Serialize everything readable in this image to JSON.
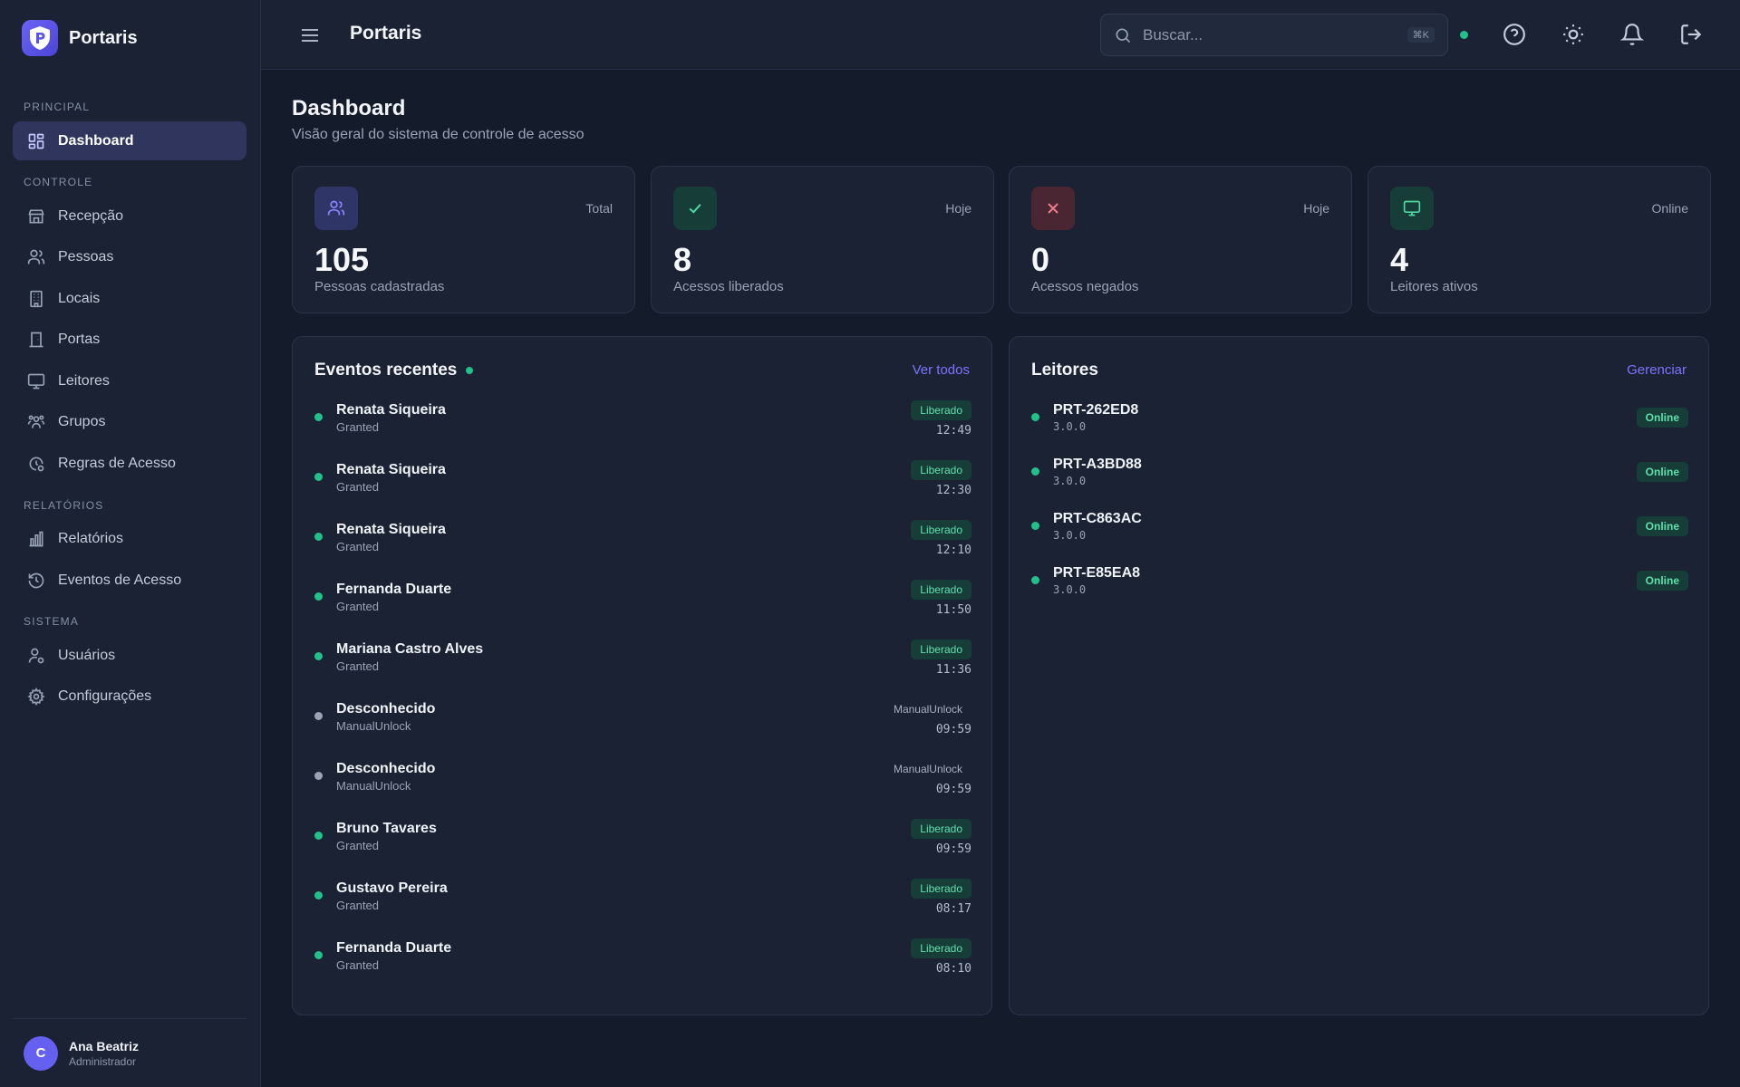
{
  "app": {
    "name": "Portaris"
  },
  "topbar": {
    "title": "Portaris",
    "search_placeholder": "Buscar...",
    "search_shortcut": "⌘K"
  },
  "sidebar": {
    "sections": [
      {
        "label": "PRINCIPAL",
        "items": [
          {
            "label": "Dashboard",
            "icon": "dashboard-icon",
            "active": true
          }
        ]
      },
      {
        "label": "CONTROLE",
        "items": [
          {
            "label": "Recepção",
            "icon": "store-icon"
          },
          {
            "label": "Pessoas",
            "icon": "users-icon"
          },
          {
            "label": "Locais",
            "icon": "building-icon"
          },
          {
            "label": "Portas",
            "icon": "door-icon"
          },
          {
            "label": "Leitores",
            "icon": "monitor-icon"
          },
          {
            "label": "Grupos",
            "icon": "group-icon"
          },
          {
            "label": "Regras de Acesso",
            "icon": "clock-rule-icon"
          }
        ]
      },
      {
        "label": "RELATÓRIOS",
        "items": [
          {
            "label": "Relatórios",
            "icon": "bar-chart-icon"
          },
          {
            "label": "Eventos de Acesso",
            "icon": "history-icon"
          }
        ]
      },
      {
        "label": "SISTEMA",
        "items": [
          {
            "label": "Usuários",
            "icon": "user-cog-icon"
          },
          {
            "label": "Configurações",
            "icon": "gear-icon"
          }
        ]
      }
    ],
    "user": {
      "initial": "C",
      "name": "Ana Beatriz",
      "role": "Administrador"
    }
  },
  "page": {
    "title": "Dashboard",
    "subtitle": "Visão geral do sistema de controle de acesso"
  },
  "stats": [
    {
      "tag": "Total",
      "value": "105",
      "label": "Pessoas cadastradas",
      "icon": "users-icon",
      "bg": "#2f3566",
      "color": "#8b86ff"
    },
    {
      "tag": "Hoje",
      "value": "8",
      "label": "Acessos liberados",
      "icon": "check-icon",
      "bg": "#173d38",
      "color": "#4fd7a0"
    },
    {
      "tag": "Hoje",
      "value": "0",
      "label": "Acessos negados",
      "icon": "x-icon",
      "bg": "#4a2633",
      "color": "#f07a8a"
    },
    {
      "tag": "Online",
      "value": "4",
      "label": "Leitores ativos",
      "icon": "monitor-icon",
      "bg": "#173d38",
      "color": "#4fd7a0"
    }
  ],
  "events": {
    "title": "Eventos recentes",
    "link": "Ver todos",
    "items": [
      {
        "name": "Renata Siqueira",
        "type": "Granted",
        "badge": "Liberado",
        "time": "12:49",
        "status": "ok"
      },
      {
        "name": "Renata Siqueira",
        "type": "Granted",
        "badge": "Liberado",
        "time": "12:30",
        "status": "ok"
      },
      {
        "name": "Renata Siqueira",
        "type": "Granted",
        "badge": "Liberado",
        "time": "12:10",
        "status": "ok"
      },
      {
        "name": "Fernanda Duarte",
        "type": "Granted",
        "badge": "Liberado",
        "time": "11:50",
        "status": "ok"
      },
      {
        "name": "Mariana Castro Alves",
        "type": "Granted",
        "badge": "Liberado",
        "time": "11:36",
        "status": "ok"
      },
      {
        "name": "Desconhecido",
        "type": "ManualUnlock",
        "badge": "ManualUnlock",
        "time": "09:59",
        "status": "manual"
      },
      {
        "name": "Desconhecido",
        "type": "ManualUnlock",
        "badge": "ManualUnlock",
        "time": "09:59",
        "status": "manual"
      },
      {
        "name": "Bruno Tavares",
        "type": "Granted",
        "badge": "Liberado",
        "time": "09:59",
        "status": "ok"
      },
      {
        "name": "Gustavo Pereira",
        "type": "Granted",
        "badge": "Liberado",
        "time": "08:17",
        "status": "ok"
      },
      {
        "name": "Fernanda Duarte",
        "type": "Granted",
        "badge": "Liberado",
        "time": "08:10",
        "status": "ok"
      }
    ]
  },
  "readers": {
    "title": "Leitores",
    "link": "Gerenciar",
    "items": [
      {
        "name": "PRT-262ED8",
        "version": "3.0.0",
        "status": "Online"
      },
      {
        "name": "PRT-A3BD88",
        "version": "3.0.0",
        "status": "Online"
      },
      {
        "name": "PRT-C863AC",
        "version": "3.0.0",
        "status": "Online"
      },
      {
        "name": "PRT-E85EA8",
        "version": "3.0.0",
        "status": "Online"
      }
    ]
  },
  "colors": {
    "accent": "#7c74ff",
    "success": "#22c08a",
    "muted_dot": "#9aa3b5"
  }
}
